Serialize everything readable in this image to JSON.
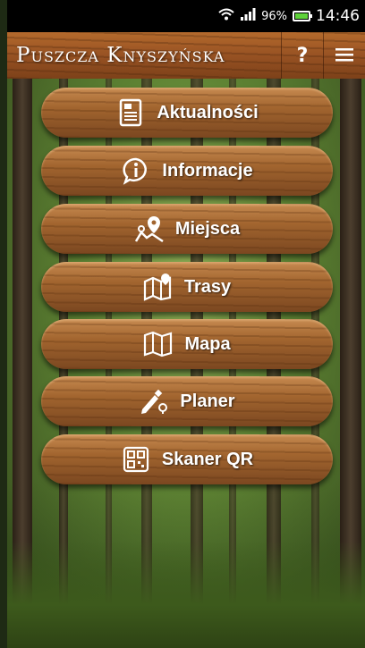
{
  "status_bar": {
    "battery_percent": "96%",
    "time": "14:46",
    "icons": [
      "wifi-icon",
      "signal-icon",
      "battery-icon"
    ]
  },
  "app_bar": {
    "title": "Puszcza Knyszyńska",
    "help_label": "?",
    "menu_icon": "hamburger-menu-icon"
  },
  "menu": {
    "items": [
      {
        "label": "Aktualności",
        "icon": "news-icon"
      },
      {
        "label": "Informacje",
        "icon": "info-icon"
      },
      {
        "label": "Miejsca",
        "icon": "place-pin-icon"
      },
      {
        "label": "Trasy",
        "icon": "route-map-icon"
      },
      {
        "label": "Mapa",
        "icon": "folded-map-icon"
      },
      {
        "label": "Planer",
        "icon": "planner-pen-icon"
      },
      {
        "label": "Skaner QR",
        "icon": "qr-code-icon"
      }
    ]
  },
  "colors": {
    "wood_light": "#c78a50",
    "wood_dark": "#7b4720",
    "forest_green": "#5f8434",
    "status_bar_bg": "#000000"
  }
}
